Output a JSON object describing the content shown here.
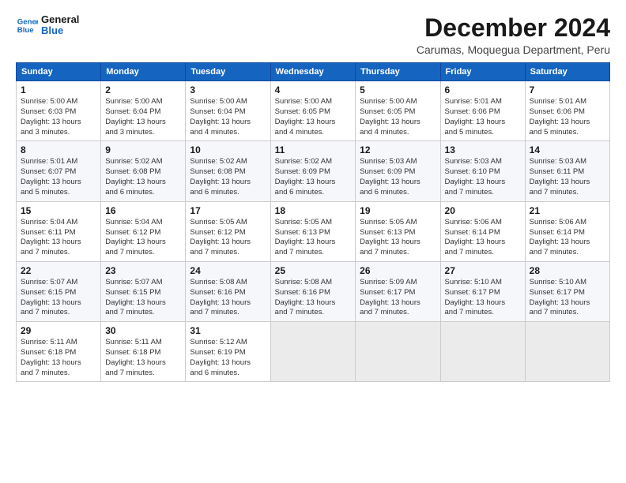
{
  "logo": {
    "line1": "General",
    "line2": "Blue"
  },
  "title": "December 2024",
  "subtitle": "Carumas, Moquegua Department, Peru",
  "weekdays": [
    "Sunday",
    "Monday",
    "Tuesday",
    "Wednesday",
    "Thursday",
    "Friday",
    "Saturday"
  ],
  "weeks": [
    [
      {
        "day": "1",
        "info": "Sunrise: 5:00 AM\nSunset: 6:03 PM\nDaylight: 13 hours\nand 3 minutes."
      },
      {
        "day": "2",
        "info": "Sunrise: 5:00 AM\nSunset: 6:04 PM\nDaylight: 13 hours\nand 3 minutes."
      },
      {
        "day": "3",
        "info": "Sunrise: 5:00 AM\nSunset: 6:04 PM\nDaylight: 13 hours\nand 4 minutes."
      },
      {
        "day": "4",
        "info": "Sunrise: 5:00 AM\nSunset: 6:05 PM\nDaylight: 13 hours\nand 4 minutes."
      },
      {
        "day": "5",
        "info": "Sunrise: 5:00 AM\nSunset: 6:05 PM\nDaylight: 13 hours\nand 4 minutes."
      },
      {
        "day": "6",
        "info": "Sunrise: 5:01 AM\nSunset: 6:06 PM\nDaylight: 13 hours\nand 5 minutes."
      },
      {
        "day": "7",
        "info": "Sunrise: 5:01 AM\nSunset: 6:06 PM\nDaylight: 13 hours\nand 5 minutes."
      }
    ],
    [
      {
        "day": "8",
        "info": "Sunrise: 5:01 AM\nSunset: 6:07 PM\nDaylight: 13 hours\nand 5 minutes."
      },
      {
        "day": "9",
        "info": "Sunrise: 5:02 AM\nSunset: 6:08 PM\nDaylight: 13 hours\nand 6 minutes."
      },
      {
        "day": "10",
        "info": "Sunrise: 5:02 AM\nSunset: 6:08 PM\nDaylight: 13 hours\nand 6 minutes."
      },
      {
        "day": "11",
        "info": "Sunrise: 5:02 AM\nSunset: 6:09 PM\nDaylight: 13 hours\nand 6 minutes."
      },
      {
        "day": "12",
        "info": "Sunrise: 5:03 AM\nSunset: 6:09 PM\nDaylight: 13 hours\nand 6 minutes."
      },
      {
        "day": "13",
        "info": "Sunrise: 5:03 AM\nSunset: 6:10 PM\nDaylight: 13 hours\nand 7 minutes."
      },
      {
        "day": "14",
        "info": "Sunrise: 5:03 AM\nSunset: 6:11 PM\nDaylight: 13 hours\nand 7 minutes."
      }
    ],
    [
      {
        "day": "15",
        "info": "Sunrise: 5:04 AM\nSunset: 6:11 PM\nDaylight: 13 hours\nand 7 minutes."
      },
      {
        "day": "16",
        "info": "Sunrise: 5:04 AM\nSunset: 6:12 PM\nDaylight: 13 hours\nand 7 minutes."
      },
      {
        "day": "17",
        "info": "Sunrise: 5:05 AM\nSunset: 6:12 PM\nDaylight: 13 hours\nand 7 minutes."
      },
      {
        "day": "18",
        "info": "Sunrise: 5:05 AM\nSunset: 6:13 PM\nDaylight: 13 hours\nand 7 minutes."
      },
      {
        "day": "19",
        "info": "Sunrise: 5:05 AM\nSunset: 6:13 PM\nDaylight: 13 hours\nand 7 minutes."
      },
      {
        "day": "20",
        "info": "Sunrise: 5:06 AM\nSunset: 6:14 PM\nDaylight: 13 hours\nand 7 minutes."
      },
      {
        "day": "21",
        "info": "Sunrise: 5:06 AM\nSunset: 6:14 PM\nDaylight: 13 hours\nand 7 minutes."
      }
    ],
    [
      {
        "day": "22",
        "info": "Sunrise: 5:07 AM\nSunset: 6:15 PM\nDaylight: 13 hours\nand 7 minutes."
      },
      {
        "day": "23",
        "info": "Sunrise: 5:07 AM\nSunset: 6:15 PM\nDaylight: 13 hours\nand 7 minutes."
      },
      {
        "day": "24",
        "info": "Sunrise: 5:08 AM\nSunset: 6:16 PM\nDaylight: 13 hours\nand 7 minutes."
      },
      {
        "day": "25",
        "info": "Sunrise: 5:08 AM\nSunset: 6:16 PM\nDaylight: 13 hours\nand 7 minutes."
      },
      {
        "day": "26",
        "info": "Sunrise: 5:09 AM\nSunset: 6:17 PM\nDaylight: 13 hours\nand 7 minutes."
      },
      {
        "day": "27",
        "info": "Sunrise: 5:10 AM\nSunset: 6:17 PM\nDaylight: 13 hours\nand 7 minutes."
      },
      {
        "day": "28",
        "info": "Sunrise: 5:10 AM\nSunset: 6:17 PM\nDaylight: 13 hours\nand 7 minutes."
      }
    ],
    [
      {
        "day": "29",
        "info": "Sunrise: 5:11 AM\nSunset: 6:18 PM\nDaylight: 13 hours\nand 7 minutes."
      },
      {
        "day": "30",
        "info": "Sunrise: 5:11 AM\nSunset: 6:18 PM\nDaylight: 13 hours\nand 7 minutes."
      },
      {
        "day": "31",
        "info": "Sunrise: 5:12 AM\nSunset: 6:19 PM\nDaylight: 13 hours\nand 6 minutes."
      },
      {
        "day": "",
        "info": ""
      },
      {
        "day": "",
        "info": ""
      },
      {
        "day": "",
        "info": ""
      },
      {
        "day": "",
        "info": ""
      }
    ]
  ]
}
